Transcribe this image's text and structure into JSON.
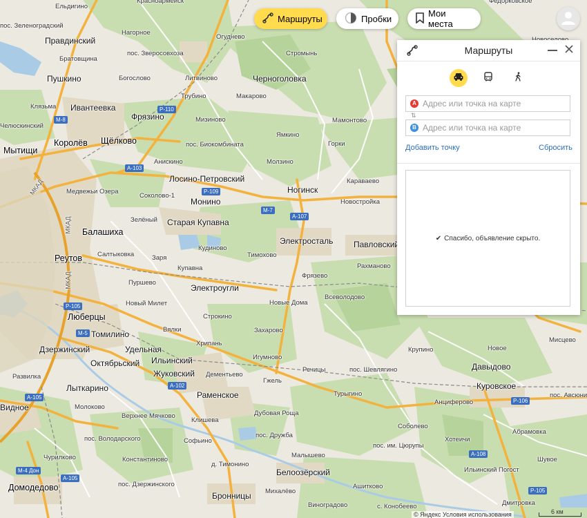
{
  "toolbar": {
    "routes_label": "Маршруты",
    "traffic_label": "Пробки",
    "places_label": "Мои места"
  },
  "panel": {
    "title": "Маршруты",
    "point_a_marker": "A",
    "point_b_marker": "B",
    "point_a_placeholder": "Адрес или точка на карте",
    "point_b_placeholder": "Адрес или точка на карте",
    "add_point": "Добавить точку",
    "reset": "Сбросить",
    "ad_message": "Спасибо, объявление скрыто."
  },
  "footer": {
    "copyright": "© Яндекс Условия использования",
    "scale": "6 км"
  },
  "map": {
    "labels": [
      {
        "text": "Красноармейск",
        "cls": "vil"
      },
      {
        "text": "Федорковское",
        "cls": "vil"
      },
      {
        "text": "Ельдигино",
        "cls": "vil"
      },
      {
        "text": "пос. Зеленоградский",
        "cls": "vil"
      },
      {
        "text": "Нагорное",
        "cls": "vil"
      },
      {
        "text": "Огуднево",
        "cls": "vil"
      },
      {
        "text": "Новоселово",
        "cls": "vil"
      },
      {
        "text": "Правдинский",
        "cls": "town"
      },
      {
        "text": "Братовщина",
        "cls": "vil"
      },
      {
        "text": "пос. Зверосовхоза",
        "cls": "vil"
      },
      {
        "text": "Стромынь",
        "cls": "vil"
      },
      {
        "text": "Пушкино",
        "cls": "town"
      },
      {
        "text": "Богослово",
        "cls": "vil"
      },
      {
        "text": "Литвиново",
        "cls": "vil"
      },
      {
        "text": "Черноголовка",
        "cls": "town"
      },
      {
        "text": "Трубино",
        "cls": "vil"
      },
      {
        "text": "Макарово",
        "cls": "vil"
      },
      {
        "text": "Клязьма",
        "cls": "vil"
      },
      {
        "text": "Ивантеевка",
        "cls": "town"
      },
      {
        "text": "Фрязино",
        "cls": "town"
      },
      {
        "text": "Мизиново",
        "cls": "vil"
      },
      {
        "text": "Мамонтово",
        "cls": "vil"
      },
      {
        "text": "Челюскинский",
        "cls": "vil"
      },
      {
        "text": "Королёв",
        "cls": "city"
      },
      {
        "text": "Щёлково",
        "cls": "city"
      },
      {
        "text": "пос. Биокомбината",
        "cls": "vil"
      },
      {
        "text": "Ямкино",
        "cls": "vil"
      },
      {
        "text": "Горки",
        "cls": "vil"
      },
      {
        "text": "Мытищи",
        "cls": "city"
      },
      {
        "text": "Анискино",
        "cls": "vil"
      },
      {
        "text": "Молзино",
        "cls": "vil"
      },
      {
        "text": "Лосино-Петровский",
        "cls": "town"
      },
      {
        "text": "Ногинск",
        "cls": "town"
      },
      {
        "text": "Караваево",
        "cls": "vil"
      },
      {
        "text": "Медвежьи Озера",
        "cls": "vil"
      },
      {
        "text": "Соколово-1",
        "cls": "vil"
      },
      {
        "text": "Монино",
        "cls": "town"
      },
      {
        "text": "Новостройка",
        "cls": "vil"
      },
      {
        "text": "Зелёный",
        "cls": "vil"
      },
      {
        "text": "Старая Купавна",
        "cls": "town"
      },
      {
        "text": "Балашиха",
        "cls": "city"
      },
      {
        "text": "Кудиново",
        "cls": "vil"
      },
      {
        "text": "Электросталь",
        "cls": "town"
      },
      {
        "text": "Павловский Посад",
        "cls": "town"
      },
      {
        "text": "Реутов",
        "cls": "city"
      },
      {
        "text": "Салтыковка",
        "cls": "vil"
      },
      {
        "text": "Заря",
        "cls": "vil"
      },
      {
        "text": "Тимохово",
        "cls": "vil"
      },
      {
        "text": "Купавна",
        "cls": "vil"
      },
      {
        "text": "Рахманово",
        "cls": "vil"
      },
      {
        "text": "Фрязево",
        "cls": "vil"
      },
      {
        "text": "Пуршево",
        "cls": "vil"
      },
      {
        "text": "Электроугли",
        "cls": "town"
      },
      {
        "text": "Всеволодово",
        "cls": "vil"
      },
      {
        "text": "Новый Милет",
        "cls": "vil"
      },
      {
        "text": "Новые Дома",
        "cls": "vil"
      },
      {
        "text": "Люберцы",
        "cls": "city"
      },
      {
        "text": "Строкино",
        "cls": "vil"
      },
      {
        "text": "Томилино",
        "cls": "town"
      },
      {
        "text": "Вялки",
        "cls": "vil"
      },
      {
        "text": "Захарово",
        "cls": "vil"
      },
      {
        "text": "Хрипань",
        "cls": "vil"
      },
      {
        "text": "Мисцево",
        "cls": "vil"
      },
      {
        "text": "Новое",
        "cls": "vil"
      },
      {
        "text": "Дзержинский",
        "cls": "town"
      },
      {
        "text": "Удельная",
        "cls": "town"
      },
      {
        "text": "Игумново",
        "cls": "vil"
      },
      {
        "text": "Крупино",
        "cls": "vil"
      },
      {
        "text": "Октябрьский",
        "cls": "town"
      },
      {
        "text": "Ильинский",
        "cls": "town"
      },
      {
        "text": "Речицы",
        "cls": "vil"
      },
      {
        "text": "пос. Шевлягино",
        "cls": "vil"
      },
      {
        "text": "Давыдово",
        "cls": "town"
      },
      {
        "text": "Развилка",
        "cls": "vil"
      },
      {
        "text": "Жуковский",
        "cls": "town"
      },
      {
        "text": "Дементьево",
        "cls": "vil"
      },
      {
        "text": "Гжель",
        "cls": "vil"
      },
      {
        "text": "Лыткарино",
        "cls": "town"
      },
      {
        "text": "Раменское",
        "cls": "town"
      },
      {
        "text": "Турыгино",
        "cls": "vil"
      },
      {
        "text": "Куровское",
        "cls": "town"
      },
      {
        "text": "Анциферово",
        "cls": "vil"
      },
      {
        "text": "пос. Авсюнино",
        "cls": "vil"
      },
      {
        "text": "Видное",
        "cls": "town"
      },
      {
        "text": "Молоково",
        "cls": "vil"
      },
      {
        "text": "Верхнее Мячково",
        "cls": "vil"
      },
      {
        "text": "Клишева",
        "cls": "vil"
      },
      {
        "text": "Дубовая Роща",
        "cls": "vil"
      },
      {
        "text": "Абрамовка",
        "cls": "vil"
      },
      {
        "text": "Соболево",
        "cls": "vil"
      },
      {
        "text": "пос. Володарского",
        "cls": "vil"
      },
      {
        "text": "Софьино",
        "cls": "vil"
      },
      {
        "text": "пос. Дружба",
        "cls": "vil"
      },
      {
        "text": "Хотеичи",
        "cls": "vil"
      },
      {
        "text": "пос. им. Цюрупы",
        "cls": "vil"
      },
      {
        "text": "Чурилково",
        "cls": "vil"
      },
      {
        "text": "Малышево",
        "cls": "vil"
      },
      {
        "text": "Константиново",
        "cls": "vil"
      },
      {
        "text": "Шувое",
        "cls": "vil"
      },
      {
        "text": "д. Тимонино",
        "cls": "vil"
      },
      {
        "text": "Ильинский Погост",
        "cls": "vil"
      },
      {
        "text": "Домодедово",
        "cls": "city"
      },
      {
        "text": "Белоозёрский",
        "cls": "town"
      },
      {
        "text": "пос. Дзержинского",
        "cls": "vil"
      },
      {
        "text": "Ашитково",
        "cls": "vil"
      },
      {
        "text": "Михалёво",
        "cls": "vil"
      },
      {
        "text": "Бронницы",
        "cls": "town"
      },
      {
        "text": "Виноградово",
        "cls": "vil"
      },
      {
        "text": "с. Конобеево",
        "cls": "vil"
      },
      {
        "text": "Дмитровка",
        "cls": "vil"
      }
    ],
    "road_labels": [
      {
        "text": "P-110"
      },
      {
        "text": "M-8"
      },
      {
        "text": "A-103"
      },
      {
        "text": "P-109"
      },
      {
        "text": "M-7"
      },
      {
        "text": "A-107"
      },
      {
        "text": "P-105"
      },
      {
        "text": "M-5"
      },
      {
        "text": "A-102"
      },
      {
        "text": "A-105"
      },
      {
        "text": "M-4 Дон"
      },
      {
        "text": "A-105"
      },
      {
        "text": "A-108"
      },
      {
        "text": "P-106"
      },
      {
        "text": "P-105"
      }
    ],
    "captions": [
      {
        "text": "МКАД"
      },
      {
        "text": "МКАД"
      },
      {
        "text": "МКАД"
      }
    ]
  }
}
